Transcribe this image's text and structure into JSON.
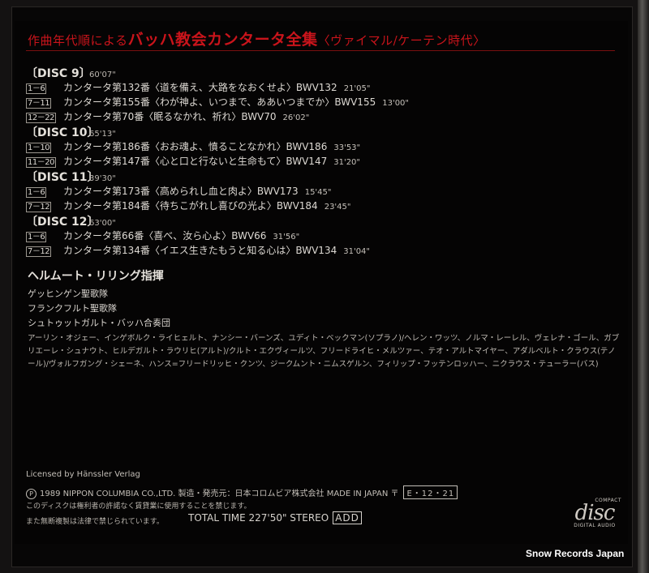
{
  "title": {
    "prefix": "作曲年代順による",
    "main": "バッハ教会カンタータ全集",
    "suffix": "〈ヴァイマル/ケーテン時代〉"
  },
  "discs": [
    {
      "name": "〔DISC 9〕",
      "time": "60'07\"",
      "tracks": [
        {
          "num": "1－6",
          "title": "カンタータ第132番〈道を備え、大路をなおくせよ〉BWV132",
          "time": "21'05\""
        },
        {
          "num": "7－11",
          "title": "カンタータ第155番〈わが神よ、いつまで、ああいつまでか〉BWV155",
          "time": "13'00\""
        },
        {
          "num": "12－22",
          "title": "カンタータ第70番〈眠るなかれ、祈れ〉BWV70",
          "time": "26'02\""
        }
      ]
    },
    {
      "name": "〔DISC 10〕",
      "time": "65'13\"",
      "tracks": [
        {
          "num": "1－10",
          "title": "カンタータ第186番〈おお魂よ、憤ることなかれ〉BWV186",
          "time": "33'53\""
        },
        {
          "num": "11－20",
          "title": "カンタータ第147番〈心と口と行ないと生命もて〉BWV147",
          "time": "31'20\""
        }
      ]
    },
    {
      "name": "〔DISC 11〕",
      "time": "39'30\"",
      "tracks": [
        {
          "num": "1－6",
          "title": "カンタータ第173番〈高められし血と肉よ〉BWV173",
          "time": "15'45\""
        },
        {
          "num": "7－12",
          "title": "カンタータ第184番〈待ちこがれし喜びの光よ〉BWV184",
          "time": "23'45\""
        }
      ]
    },
    {
      "name": "〔DISC 12〕",
      "time": "63'00\"",
      "tracks": [
        {
          "num": "1－6",
          "title": "カンタータ第66番〈喜べ、汝ら心よ〉BWV66",
          "time": "31'56\""
        },
        {
          "num": "7－12",
          "title": "カンタータ第134番〈イエス生きたもうと知る心は〉BWV134",
          "time": "31'04\""
        }
      ]
    }
  ],
  "conductor": "ヘルムート・リリング指揮",
  "choirs": [
    "ゲッヒンゲン聖歌隊",
    "フランクフルト聖歌隊",
    "シュトゥットガルト・バッハ合奏団"
  ],
  "soloists": "アーリン・オジェー、インゲボルク・ライヒェルト、ナンシー・バーンズ、ユディト・ベックマン(ソプラノ)/ヘレン・ワッツ、ノルマ・レーレル、ヴェレナ・ゴール、ガブリエーレ・シュナウト、ヒルデガルト・ラウリヒ(アルト)/クルト・エクヴィールツ、フリードライヒ・メルツァー、テオ・アルトマイヤー、アダルベルト・クラウス(テノール)/ヴォルフガング・シェーネ、ハンス=フリードリッヒ・クンツ、ジークムント・ニムスゲルン、フィリップ・フッテンロッハー、ニクラウス・テューラー(バス)",
  "license": "Licensed by Hänssler Verlag",
  "copyright": {
    "pmark": "P",
    "text": "1989 NIPPON COLUMBIA CO.,LTD. 製造・発売元：日本コロムビア株式会社 MADE IN JAPAN 〒",
    "catalog": "E・12・21"
  },
  "notice1": "このディスクは権利者の許諾なく賃貸業に使用することを禁じます。",
  "notice2": "また無断複製は法律で禁じられています。",
  "total": {
    "label": "TOTAL TIME 227'50\"  STEREO",
    "add": "ADD"
  },
  "cd_logo": {
    "top": "COMPACT",
    "word": "disc",
    "bottom": "DIGITAL AUDIO"
  },
  "watermark": "Snow Records Japan",
  "colors": {
    "accent": "#c9141b",
    "background": "#050404",
    "text": "#d6d2cc"
  }
}
